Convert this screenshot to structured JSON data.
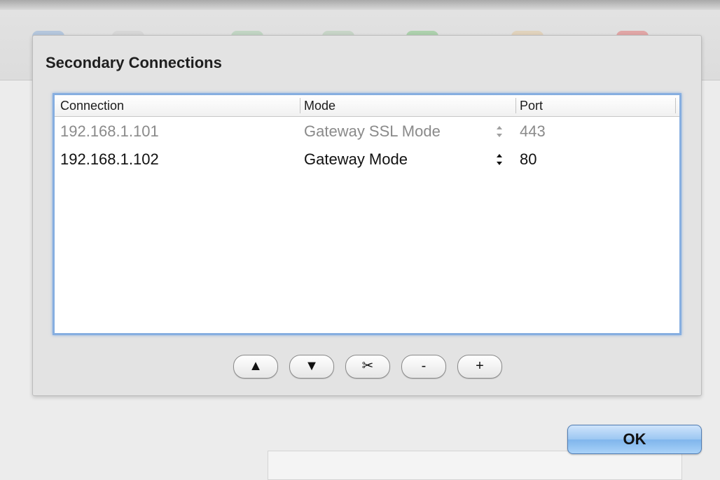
{
  "sheet": {
    "title": "Secondary Connections"
  },
  "table": {
    "columns": [
      "Connection",
      "Mode",
      "Port"
    ],
    "rows": [
      {
        "connection": "192.168.1.101",
        "mode": "Gateway SSL Mode",
        "port": "443",
        "state": "disabled"
      },
      {
        "connection": "192.168.1.102",
        "mode": "Gateway Mode",
        "port": "80",
        "state": "enabled"
      }
    ]
  },
  "buttons": {
    "move_up": "▲",
    "move_down": "▼",
    "cut": "✂",
    "remove": "-",
    "add": "+",
    "ok": "OK"
  },
  "colors": {
    "focus_ring": "#86aee0",
    "ok_button": "#9cc7f2"
  }
}
